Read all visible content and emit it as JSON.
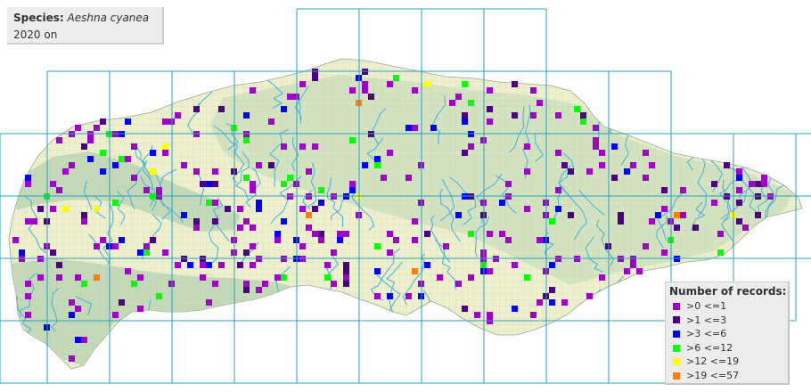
{
  "info": {
    "species_label": "Species:",
    "species_name": "Aeshna cyanea",
    "period": "2020 on"
  },
  "legend": {
    "title": "Number of records:",
    "items": [
      {
        "label": ">0 <=1",
        "color": "#9e00c8"
      },
      {
        "label": ">1 <=3",
        "color": "#4b0082"
      },
      {
        "label": ">3 <=6",
        "color": "#0000ff"
      },
      {
        "label": ">6 <=12",
        "color": "#00ff00"
      },
      {
        "label": ">12 <=19",
        "color": "#ffff00"
      },
      {
        "label": ">19 <=57",
        "color": "#ff7f00"
      }
    ]
  },
  "map_colors": {
    "background": "#ffffff",
    "land": "#eef0cc",
    "chalk": "#b4d2b0",
    "rivers": "#4fb3d8",
    "grid": "#28a0c0"
  }
}
